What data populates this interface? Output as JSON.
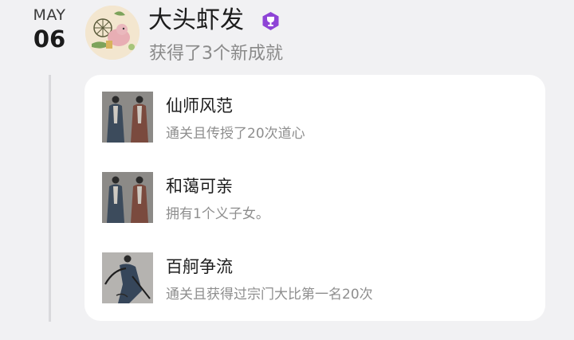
{
  "date": {
    "month": "MAY",
    "day": "06"
  },
  "user": {
    "name": "大头虾发",
    "avatar": "avatar-illustration",
    "badge_icon": "trophy-badge-icon",
    "badge_color": "#8e44d6"
  },
  "summary": "获得了3个新成就",
  "achievements": [
    {
      "title": "仙师风范",
      "description": "通关且传授了20次道心",
      "icon": "two-robed-figures"
    },
    {
      "title": "和蔼可亲",
      "description": "拥有1个义子女。",
      "icon": "two-robed-figures"
    },
    {
      "title": "百舸争流",
      "description": "通关且获得过宗门大比第一名20次",
      "icon": "swordsman"
    }
  ]
}
